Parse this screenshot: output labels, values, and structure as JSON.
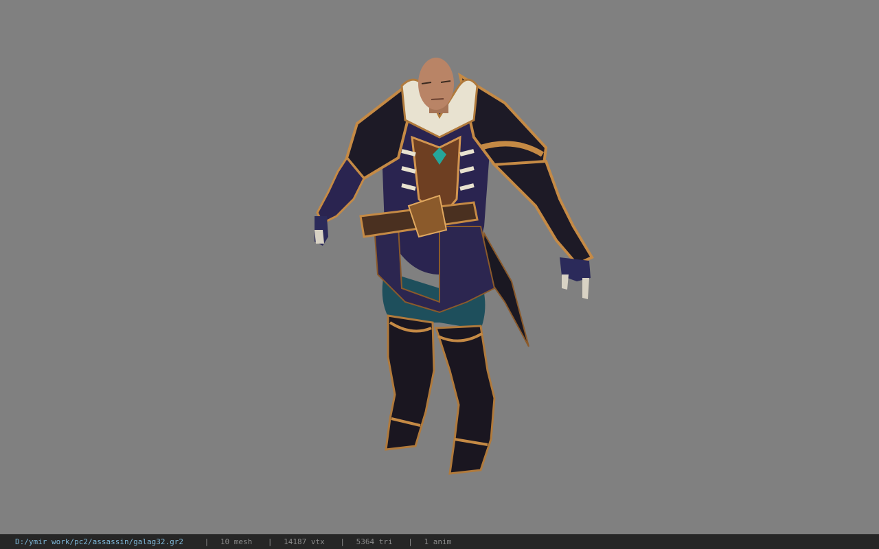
{
  "viewer": {
    "background_color": "#808080",
    "model_subject": "armored assassin character in T-pose"
  },
  "status_bar": {
    "file_path": "D:/ymir work/pc2/assassin/galag32.gr2",
    "mesh": "10 mesh",
    "vertices": "14187 vtx",
    "triangles": "5364 tri",
    "animations": "1 anim",
    "separator": "|",
    "path_color": "#7fb8d8",
    "text_color": "#8a8a8a"
  }
}
